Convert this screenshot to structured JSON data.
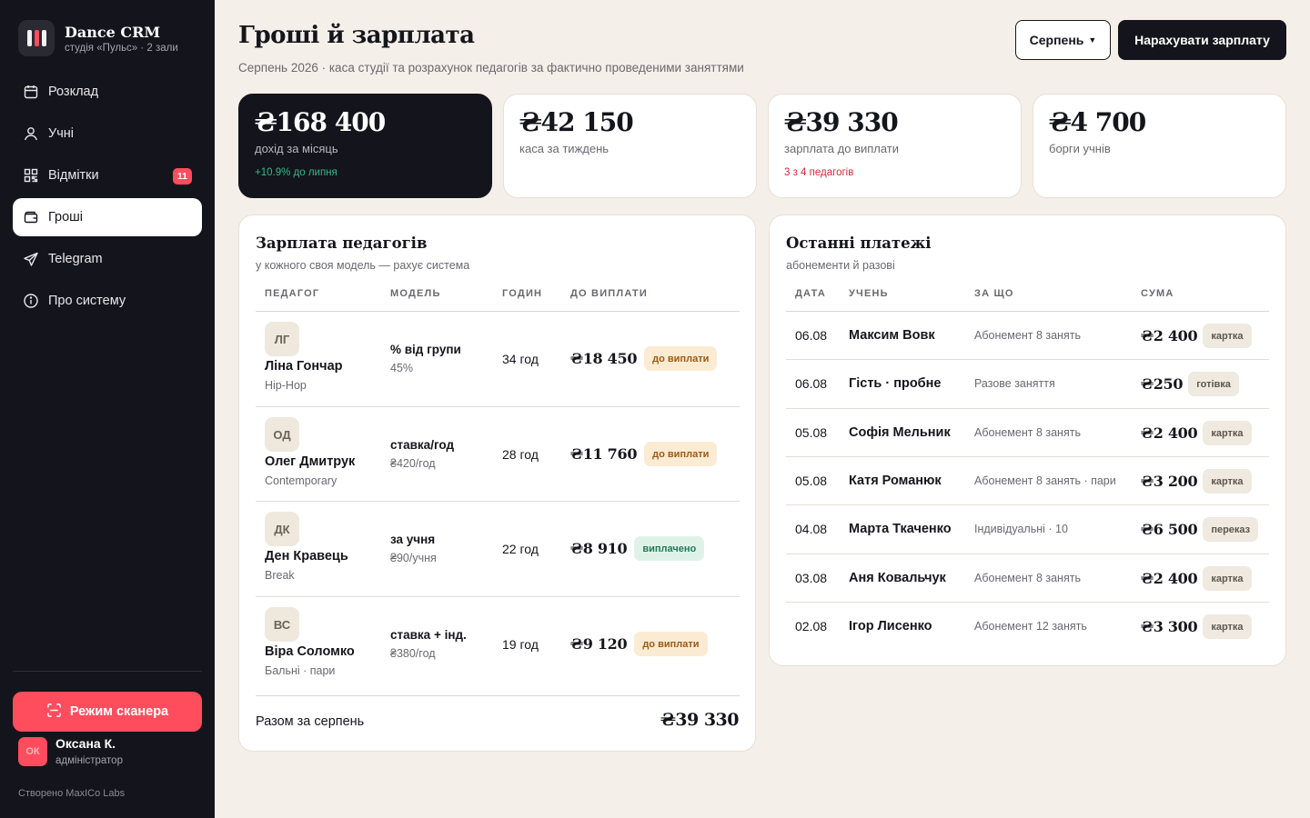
{
  "brand": {
    "name": "Dance CRM",
    "subtitle": "студія «Пульс» · 2 зали"
  },
  "nav": [
    {
      "label": "Розклад",
      "icon": "calendar-icon"
    },
    {
      "label": "Учні",
      "icon": "user-icon"
    },
    {
      "label": "Відмітки",
      "icon": "qr-grid-icon",
      "badge": "11"
    },
    {
      "label": "Гроші",
      "icon": "wallet-icon",
      "active": true
    },
    {
      "label": "Telegram",
      "icon": "send-icon"
    },
    {
      "label": "Про систему",
      "icon": "info-icon"
    }
  ],
  "scanner_label": "Режим сканера",
  "user": {
    "initials": "ОК",
    "name": "Оксана К.",
    "role": "адміністратор"
  },
  "credit": "Створено MaxICo Labs",
  "header": {
    "title": "Гроші й зарплата",
    "subtitle": "Серпень 2026 · каса студії та розрахунок педагогів за фактично проведеними заняттями",
    "month": "Серпень",
    "accrue_label": "Нарахувати зарплату"
  },
  "kpis": [
    {
      "value": "₴168 400",
      "label": "дохід за місяць",
      "note": "+10.9% до липня"
    },
    {
      "value": "₴42 150",
      "label": "каса за тиждень",
      "note": ""
    },
    {
      "value": "₴39 330",
      "label": "зарплата до виплати",
      "note": "3 з 4 педагогів"
    },
    {
      "value": "₴4 700",
      "label": "борги учнів",
      "note": ""
    }
  ],
  "salary": {
    "title": "Зарплата педагогів",
    "subtitle": "у кожного своя модель — рахує система",
    "columns": [
      "ПЕДАГОГ",
      "МОДЕЛЬ",
      "ГОДИН",
      "ДО ВИПЛАТИ"
    ],
    "rows": [
      {
        "initials": "ЛГ",
        "name": "Ліна Гончар",
        "style": "Hip-Hop",
        "model": "% від групи",
        "model_detail": "45%",
        "hours": "34 год",
        "amount": "₴18 450",
        "status": "до виплати",
        "status_type": "due"
      },
      {
        "initials": "ОД",
        "name": "Олег Дмитрук",
        "style": "Contemporary",
        "model": "ставка/год",
        "model_detail": "₴420/год",
        "hours": "28 год",
        "amount": "₴11 760",
        "status": "до виплати",
        "status_type": "due"
      },
      {
        "initials": "ДК",
        "name": "Ден Кравець",
        "style": "Break",
        "model": "за учня",
        "model_detail": "₴90/учня",
        "hours": "22 год",
        "amount": "₴8 910",
        "status": "виплачено",
        "status_type": "paid"
      },
      {
        "initials": "ВС",
        "name": "Віра Соломко",
        "style": "Бальні · пари",
        "model": "ставка + інд.",
        "model_detail": "₴380/год",
        "hours": "19 год",
        "amount": "₴9 120",
        "status": "до виплати",
        "status_type": "due"
      }
    ],
    "total_label": "Разом за серпень",
    "total_value": "₴39 330"
  },
  "payments": {
    "title": "Останні платежі",
    "subtitle": "абонементи й разові",
    "columns": [
      "ДАТА",
      "УЧЕНЬ",
      "ЗА ЩО",
      "СУМА"
    ],
    "rows": [
      {
        "date": "06.08",
        "student": "Максим Вовк",
        "what": "Абонемент 8 занять",
        "amount": "₴2 400",
        "method": "картка"
      },
      {
        "date": "06.08",
        "student": "Гість · пробне",
        "what": "Разове заняття",
        "amount": "₴250",
        "method": "готівка"
      },
      {
        "date": "05.08",
        "student": "Софія Мельник",
        "what": "Абонемент 8 занять",
        "amount": "₴2 400",
        "method": "картка"
      },
      {
        "date": "05.08",
        "student": "Катя Романюк",
        "what": "Абонемент 8 занять · пари",
        "amount": "₴3 200",
        "method": "картка"
      },
      {
        "date": "04.08",
        "student": "Марта Ткаченко",
        "what": "Індивідуальні · 10",
        "amount": "₴6 500",
        "method": "переказ"
      },
      {
        "date": "03.08",
        "student": "Аня Ковальчук",
        "what": "Абонемент 8 занять",
        "amount": "₴2 400",
        "method": "картка"
      },
      {
        "date": "02.08",
        "student": "Ігор Лисенко",
        "what": "Абонемент 12 занять",
        "amount": "₴3 300",
        "method": "картка"
      }
    ]
  }
}
